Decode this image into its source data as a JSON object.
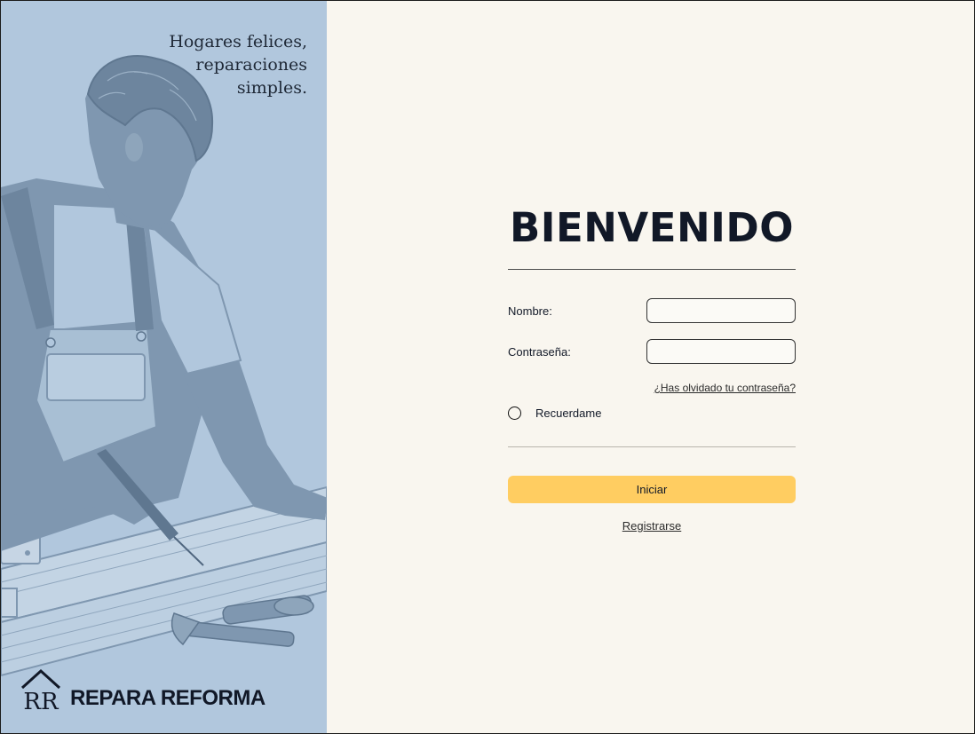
{
  "brand": {
    "tagline": [
      "Hogares felices,",
      "reparaciones",
      "simples."
    ],
    "logo_text": "REPARA REFORMA",
    "logo_monogram": "RR"
  },
  "form": {
    "title": "BIENVENIDO",
    "name_label": "Nombre:",
    "name_value": "",
    "password_label": "Contraseña:",
    "password_value": "",
    "forgot_link": "¿Has olvidado tu contraseña?",
    "remember_label": "Recuerdame",
    "remember_checked": false,
    "submit_label": "Iniciar",
    "register_link": "Registrarse"
  },
  "colors": {
    "panel_blue": "#b1c7dd",
    "illustration_blue": "#7f97b0",
    "background_cream": "#f9f6ef",
    "button_yellow": "#ffcd61",
    "text_dark": "#111827"
  }
}
